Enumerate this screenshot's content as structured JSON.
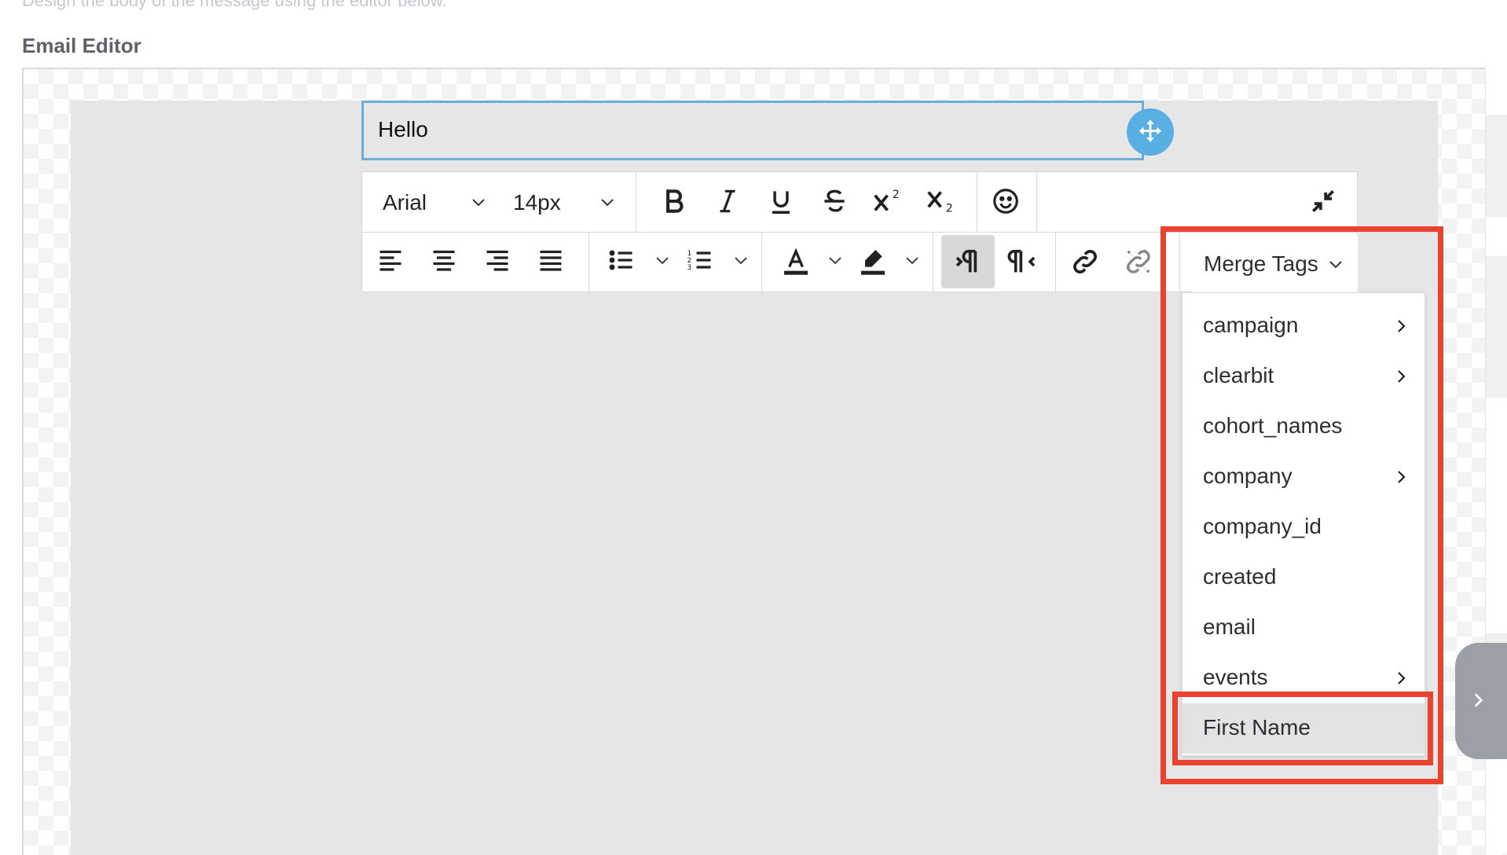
{
  "header": {
    "hint_text": "Design the body of the message using the editor below.",
    "section_label": "Email Editor"
  },
  "text_block": {
    "content": "Hello"
  },
  "toolbar": {
    "font_family": "Arial",
    "font_size": "14px",
    "merge_tags_label": "Merge Tags",
    "icons": [
      "bold-icon",
      "italic-icon",
      "underline-icon",
      "strikethrough-icon",
      "superscript-icon",
      "subscript-icon",
      "emoji-icon",
      "collapse-icon",
      "align-left-icon",
      "align-center-icon",
      "align-right-icon",
      "align-justify-icon",
      "bullet-list-icon",
      "numbered-list-icon",
      "text-color-icon",
      "highlight-icon",
      "ltr-icon",
      "rtl-icon",
      "link-icon",
      "unlink-icon"
    ]
  },
  "merge_tags": {
    "items": [
      {
        "label": "campaign",
        "has_submenu": true
      },
      {
        "label": "clearbit",
        "has_submenu": true
      },
      {
        "label": "cohort_names",
        "has_submenu": false
      },
      {
        "label": "company",
        "has_submenu": true
      },
      {
        "label": "company_id",
        "has_submenu": false
      },
      {
        "label": "created",
        "has_submenu": false
      },
      {
        "label": "email",
        "has_submenu": false
      },
      {
        "label": "events",
        "has_submenu": true
      },
      {
        "label": "First Name",
        "has_submenu": false
      }
    ],
    "highlighted": "First Name"
  },
  "colors": {
    "highlight": "#e9422e",
    "accent": "#59aee3",
    "canvas": "#e6e6e7"
  }
}
